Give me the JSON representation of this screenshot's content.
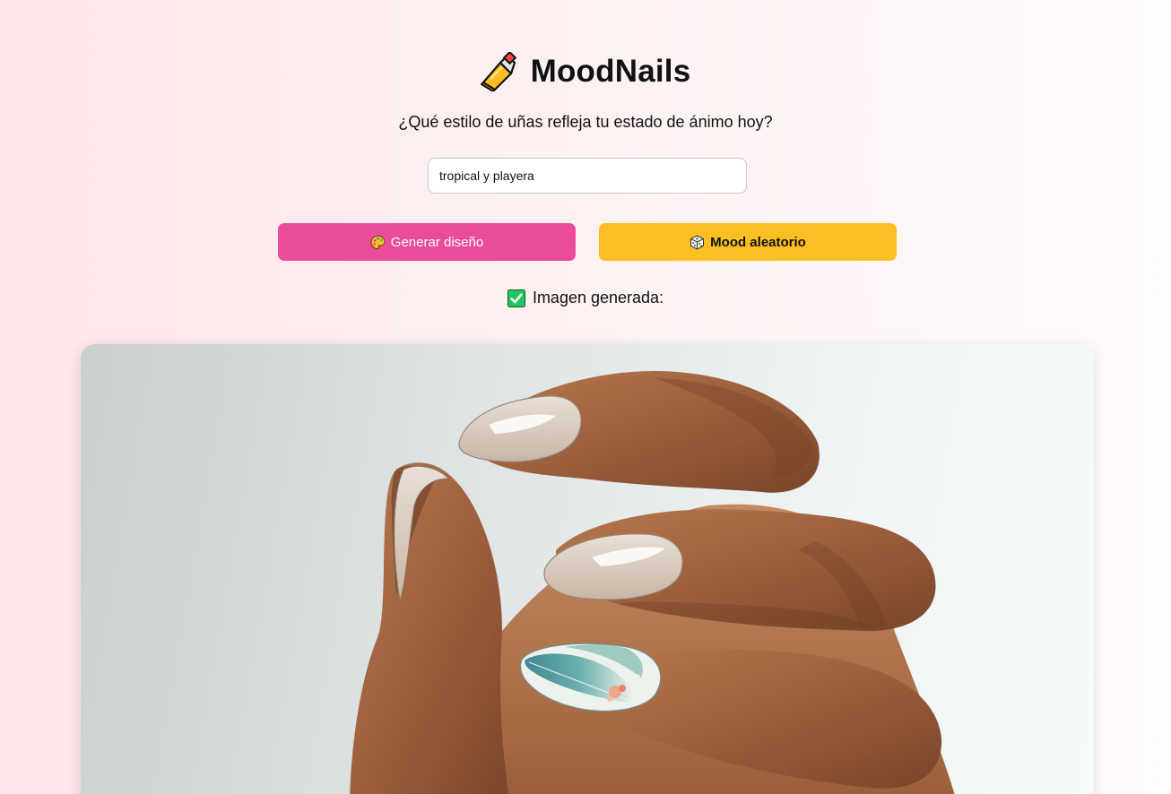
{
  "app": {
    "title": "MoodNails",
    "logo_icon": "nail-polish-icon"
  },
  "prompt": {
    "question": "¿Qué estilo de uñas refleja tu estado de ánimo hoy?",
    "input_value": "tropical y playera"
  },
  "actions": {
    "generate_label": "Generar diseño",
    "generate_icon": "palette-icon",
    "random_label": "Mood aleatorio",
    "random_icon": "dice-icon"
  },
  "status": {
    "text": "Imagen generada:",
    "icon": "check-mark-icon"
  },
  "colors": {
    "generate_button": "#ea4c9a",
    "random_button": "#fbbf24",
    "page_gradient_start": "#fde6e8",
    "page_gradient_end": "#fffcfc"
  }
}
